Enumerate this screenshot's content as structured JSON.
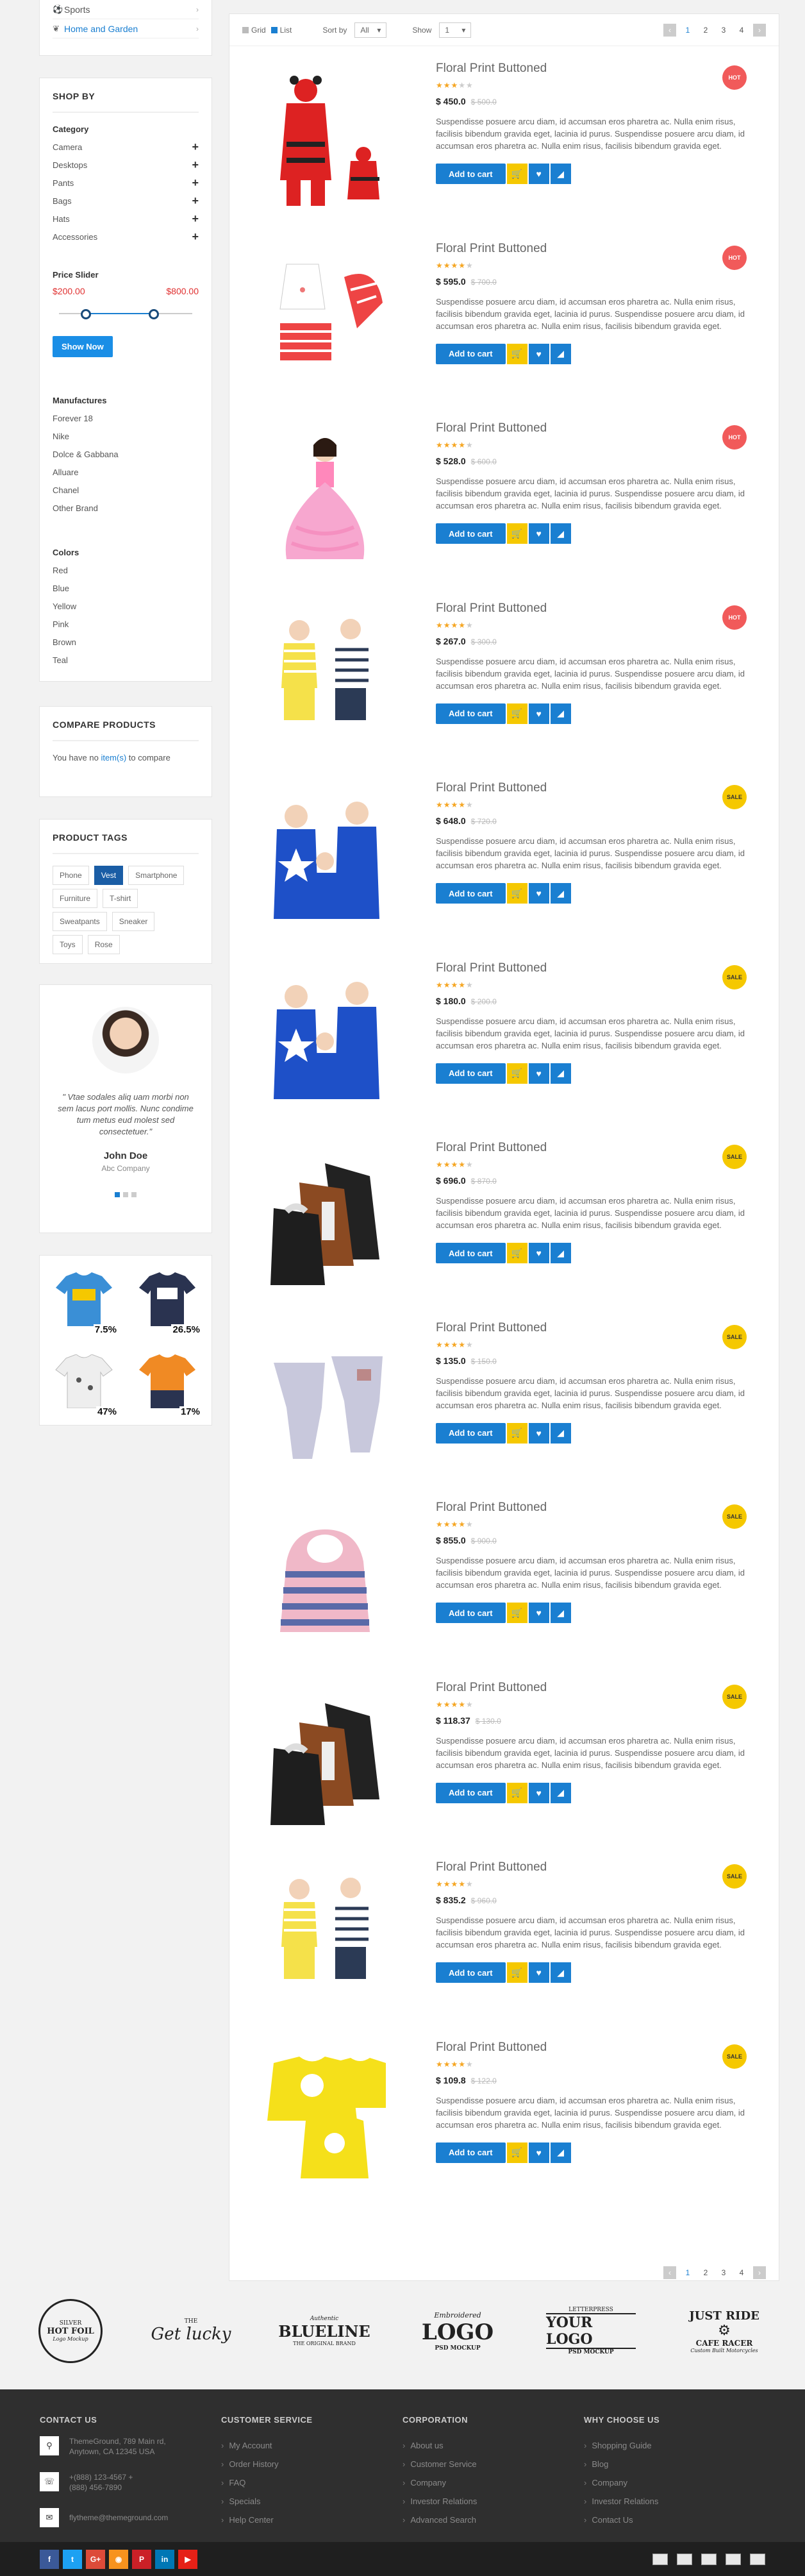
{
  "sidebar": {
    "top_categories": [
      {
        "label": "Sports",
        "icon": "soccer-ball-icon"
      },
      {
        "label": "Home and Garden",
        "icon": "leaf-icon"
      }
    ],
    "shop_by": {
      "title": "SHOP BY",
      "category_title": "Category",
      "categories": [
        "Camera",
        "Desktops",
        "Pants",
        "Bags",
        "Hats",
        "Accessories"
      ],
      "price_title": "Price Slider",
      "price_min": "$200.00",
      "price_max": "$800.00",
      "show_button": "Show Now",
      "manufacturers_title": "Manufactures",
      "manufacturers": [
        "Forever 18",
        "Nike",
        "Dolce & Gabbana",
        "Alluare",
        "Chanel",
        "Other Brand"
      ],
      "colors_title": "Colors",
      "colors": [
        "Red",
        "Blue",
        "Yellow",
        "Pink",
        "Brown",
        "Teal"
      ]
    },
    "compare": {
      "title": "COMPARE PRODUCTS",
      "text_before": "You have no ",
      "link": "item(s)",
      "text_after": " to compare"
    },
    "tags": {
      "title": "PRODUCT TAGS",
      "items": [
        "Phone",
        "Vest",
        "Smartphone",
        "Furniture",
        "T-shirt",
        "Sweatpants",
        "Sneaker",
        "Toys",
        "Rose"
      ],
      "active": "Vest"
    },
    "testimonial": {
      "quote": "\" Vtae sodales aliq uam morbi non sem lacus port mollis. Nunc condime tum metus eud molest sed consectetuer.\"",
      "name": "John Doe",
      "company": "Abc Company"
    },
    "promo_labels": [
      "7.5%",
      "26.5%",
      "47%",
      "17%"
    ]
  },
  "toolbar": {
    "grid_label": "Grid",
    "list_label": "List",
    "sort_label": "Sort by",
    "sort_value": "All",
    "show_label": "Show",
    "show_value": "1",
    "pages": [
      "1",
      "2",
      "3",
      "4"
    ]
  },
  "product_common": {
    "name": "Floral Print Buttoned",
    "description": "Suspendisse posuere arcu diam, id accumsan eros pharetra ac. Nulla enim risus, facilisis bibendum gravida eget, lacinia id purus. Suspendisse posuere arcu diam, id accumsan eros pharetra ac. Nulla enim risus, facilisis bibendum gravida eget.",
    "add_to_cart": "Add to cart"
  },
  "products": [
    {
      "price": "$ 450.0",
      "old_price": "$ 500.0",
      "badge": "HOT",
      "rating": 3
    },
    {
      "price": "$ 595.0",
      "old_price": "$ 700.0",
      "badge": "HOT",
      "rating": 4
    },
    {
      "price": "$ 528.0",
      "old_price": "$ 600.0",
      "badge": "HOT",
      "rating": 4
    },
    {
      "price": "$ 267.0",
      "old_price": "$ 300.0",
      "badge": "HOT",
      "rating": 4
    },
    {
      "price": "$ 648.0",
      "old_price": "$ 720.0",
      "badge": "SALE",
      "rating": 4
    },
    {
      "price": "$ 180.0",
      "old_price": "$ 200.0",
      "badge": "SALE",
      "rating": 4
    },
    {
      "price": "$ 696.0",
      "old_price": "$ 870.0",
      "badge": "SALE",
      "rating": 4
    },
    {
      "price": "$ 135.0",
      "old_price": "$ 150.0",
      "badge": "SALE",
      "rating": 4
    },
    {
      "price": "$ 855.0",
      "old_price": "$ 900.0",
      "badge": "SALE",
      "rating": 4
    },
    {
      "price": "$ 118.37",
      "old_price": "$ 130.0",
      "badge": "SALE",
      "rating": 4
    },
    {
      "price": "$ 835.2",
      "old_price": "$ 960.0",
      "badge": "SALE",
      "rating": 4
    },
    {
      "price": "$ 109.8",
      "old_price": "$ 122.0",
      "badge": "SALE",
      "rating": 4
    }
  ],
  "brands": [
    {
      "line1": "SILVER",
      "line2": "HOT FOIL",
      "line3": "Logo Mockup"
    },
    {
      "line1": "THE",
      "line2": "Get lucky",
      "line3": ""
    },
    {
      "line1": "Authentic",
      "line2": "BLUELINE",
      "line3": "THE ORIGINAL BRAND"
    },
    {
      "line1": "Embroidered",
      "line2": "LOGO",
      "line3": "PSD MOCKUP"
    },
    {
      "line1": "LETTERPRESS",
      "line2": "YOUR LOGO",
      "line3": "PSD MOCKUP"
    },
    {
      "line1": "JUST RIDE",
      "line2": "CAFE RACER",
      "line3": "Custom Built Motorcycles"
    }
  ],
  "footer": {
    "contact_title": "CONTACT US",
    "address": "ThemeGround, 789 Main rd, Anytown, CA 12345 USA",
    "phone": "+(888) 123-4567 +(888) 456-7890",
    "email": "flytheme@themeground.com",
    "col2_title": "CUSTOMER SERVICE",
    "col2": [
      "My Account",
      "Order History",
      "FAQ",
      "Specials",
      "Help Center"
    ],
    "col3_title": "CORPORATION",
    "col3": [
      "About us",
      "Customer Service",
      "Company",
      "Investor Relations",
      "Advanced Search"
    ],
    "col4_title": "WHY CHOOSE US",
    "col4": [
      "Shopping Guide",
      "Blog",
      "Company",
      "Investor Relations",
      "Contact Us"
    ],
    "social": [
      {
        "icon": "facebook-icon",
        "glyph": "f",
        "color": "#3b5998"
      },
      {
        "icon": "twitter-icon",
        "glyph": "t",
        "color": "#1da1f2"
      },
      {
        "icon": "google-plus-icon",
        "glyph": "G+",
        "color": "#dd4b39"
      },
      {
        "icon": "rss-icon",
        "glyph": "◉",
        "color": "#f7931e"
      },
      {
        "icon": "pinterest-icon",
        "glyph": "P",
        "color": "#cb2027"
      },
      {
        "icon": "linkedin-icon",
        "glyph": "in",
        "color": "#0077b5"
      },
      {
        "icon": "youtube-icon",
        "glyph": "▶",
        "color": "#e62117"
      }
    ]
  }
}
